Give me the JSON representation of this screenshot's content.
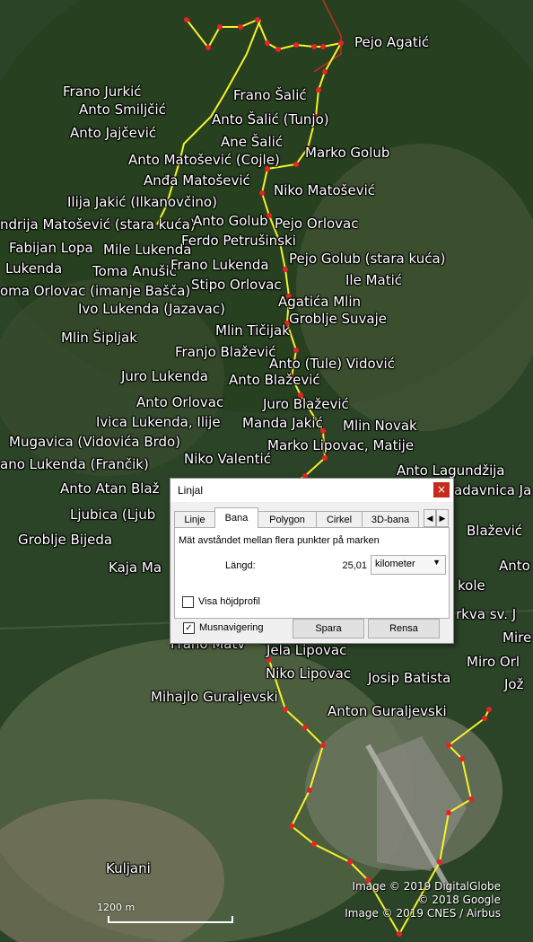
{
  "map": {
    "places": [
      {
        "name": "Pejo Agatić"
      },
      {
        "name": "Frano Jurkić"
      },
      {
        "name": "Anto Smiljčić"
      },
      {
        "name": "Anto Jajčević"
      },
      {
        "name": "Frano Šalić"
      },
      {
        "name": "Anto Šalić (Tunjo)"
      },
      {
        "name": "Ane Šalić"
      },
      {
        "name": "Marko Golub"
      },
      {
        "name": "Anto Matošević (Cojle)"
      },
      {
        "name": "Anđa Matošević"
      },
      {
        "name": "Niko Matošević"
      },
      {
        "name": "Ilija Jakić (Ilkanovčino)"
      },
      {
        "name": "ndrija Matošević (stara kuća)"
      },
      {
        "name": "Anto Golub"
      },
      {
        "name": "Pejo Orlovac"
      },
      {
        "name": "Ferdo Petrušinski"
      },
      {
        "name": "Fabijan Lopa"
      },
      {
        "name": "Mile Lukenda"
      },
      {
        "name": "Pejo Golub (stara kuća)"
      },
      {
        "name": "Lukenda"
      },
      {
        "name": "Toma Anušić"
      },
      {
        "name": "Frano Lukenda"
      },
      {
        "name": "Ile Matić"
      },
      {
        "name": "oma Orlovac (imanje Bašča)"
      },
      {
        "name": "Stipo Orlovac"
      },
      {
        "name": "Agatića Mlin"
      },
      {
        "name": "Ivo Lukenda (Jazavac)"
      },
      {
        "name": "Groblje Suvaje"
      },
      {
        "name": "Mlin Tičijak"
      },
      {
        "name": "Mlin Šipljak"
      },
      {
        "name": "Franjo Blažević"
      },
      {
        "name": "Anto (Tule) Vidović"
      },
      {
        "name": "Juro Lukenda"
      },
      {
        "name": "Anto Blažević"
      },
      {
        "name": "Anto Orlovac"
      },
      {
        "name": "Juro Blažević"
      },
      {
        "name": "Ivica Lukenda, Ilije"
      },
      {
        "name": "Manda Jakić"
      },
      {
        "name": "Mlin Novak"
      },
      {
        "name": "Mugavica (Vidovića Brdo)"
      },
      {
        "name": "Marko Lipovac, Matije"
      },
      {
        "name": "Niko Valentić"
      },
      {
        "name": "ano Lukenda (Frančik)"
      },
      {
        "name": "Anto Lagundžija"
      },
      {
        "name": "Anto Atan Blaž"
      },
      {
        "name": "adavnica Ja"
      },
      {
        "name": "Ljubica (Ljub"
      },
      {
        "name": "Blažević"
      },
      {
        "name": "Groblje Bijeda"
      },
      {
        "name": "Kaja Ma"
      },
      {
        "name": "Anto"
      },
      {
        "name": "kole"
      },
      {
        "name": "rkva sv. J"
      },
      {
        "name": "Mire"
      },
      {
        "name": "Frano Matv"
      },
      {
        "name": "Jela Lipovac"
      },
      {
        "name": "Miro Orl"
      },
      {
        "name": "Niko Lipovac"
      },
      {
        "name": "Josip Batista"
      },
      {
        "name": "Jož"
      },
      {
        "name": "Mihajlo Guraljevski"
      },
      {
        "name": "Anton Guraljevski"
      },
      {
        "name": "Kuljani"
      }
    ],
    "credits": [
      "Image © 2019 DigitalGlobe",
      "© 2018 Google",
      "Image © 2019 CNES / Airbus"
    ],
    "scale_label": "1200 m",
    "colors": {
      "path": "#f5f22a",
      "vertex": "#e8202a",
      "forest": "#2f4a2a",
      "field": "#6b6b4a"
    }
  },
  "dialog": {
    "title": "Linjal",
    "close_icon": "×",
    "tabs": [
      "Linje",
      "Bana",
      "Polygon",
      "Cirkel",
      "3D-bana"
    ],
    "active_tab": "Bana",
    "description": "Mät avståndet mellan flera punkter på marken",
    "length_label": "Längd:",
    "length_value": "25,01",
    "unit": "kilometer",
    "elevation_profile_label": "Visa höjdprofil",
    "elevation_profile_checked": false,
    "mouse_nav_label": "Musnavigering",
    "mouse_nav_checked": true,
    "save_label": "Spara",
    "clear_label": "Rensa"
  }
}
